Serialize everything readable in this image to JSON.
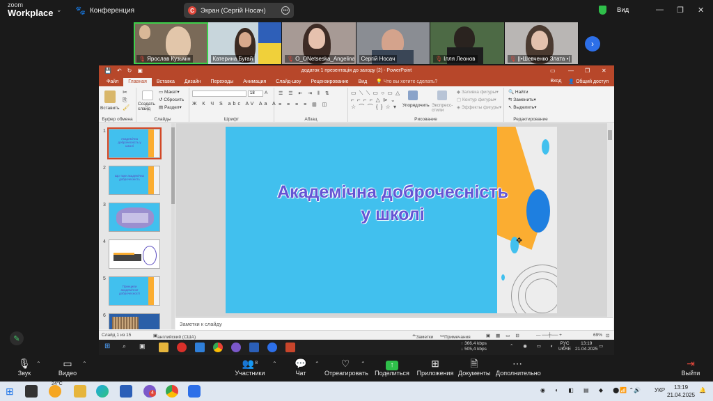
{
  "zoom": {
    "brand_top": "zoom",
    "brand_bottom": "Workplace",
    "meeting_title": "Конференция",
    "screen_share_label": "Экран (Сергій Носач)",
    "screen_share_badge": "С",
    "view_label": "Вид",
    "participants": [
      {
        "name": "Ярослав Кузьмін",
        "muted": true
      },
      {
        "name": "Катерина Бугай",
        "muted": false
      },
      {
        "name": "O_ONetseska_Angelina...",
        "muted": true
      },
      {
        "name": "Сергій Носач",
        "muted": false
      },
      {
        "name": "Ілля Леонов",
        "muted": true
      },
      {
        "name": "||•Шевченко Злата •|",
        "muted": true
      }
    ],
    "toolbar": {
      "audio": "Звук",
      "video": "Видео",
      "participants": "Участники",
      "participants_count": "8",
      "chat": "Чат",
      "react": "Отреагировать",
      "share": "Поделиться",
      "apps": "Приложения",
      "docs": "Документы",
      "more": "Дополнительно",
      "leave": "Выйти"
    },
    "accent_green": "#2fbf4a",
    "accent_blue": "#2d6fe8"
  },
  "ppt": {
    "doc_title": "додаток 1 презентація до заходу (2)  -  PowerPoint",
    "tabs": [
      "Файл",
      "Главная",
      "Вставка",
      "Дизайн",
      "Переходы",
      "Анимация",
      "Слайд-шоу",
      "Рецензирование",
      "Вид"
    ],
    "tell_me": "Что вы хотите сделать?",
    "sign_in": "Вход",
    "share": "Общий доступ",
    "ribbon": {
      "paste": "Вставить",
      "clipboard": "Буфер обмена",
      "new_slide": "Создать слайд",
      "layout": "Макет",
      "reset": "Сбросить",
      "section": "Раздел",
      "slides": "Слайды",
      "font": "Шрифт",
      "font_size": "18",
      "paragraph": "Абзац",
      "arrange": "Упорядочить",
      "quick_styles": "Экспресс-стили",
      "drawing": "Рисование",
      "shape_fill": "Заливка фигуры",
      "shape_outline": "Контур фигуры",
      "shape_effects": "Эффекты фигуры",
      "find": "Найти",
      "replace": "Заменить",
      "select": "Выделить",
      "editing": "Редактирование"
    },
    "thumb_numbers": [
      "1",
      "2",
      "3",
      "4",
      "5",
      "6"
    ],
    "thumb_titles": [
      "Академічна доброчесність у школі",
      "Що таке академічна доброчесність",
      "",
      "",
      "Принципи академічної доброчесності",
      ""
    ],
    "slide_title_line1": "Академічна доброчесність",
    "slide_title_line2": "у школі",
    "notes_placeholder": "Заметки к слайду",
    "status_slide": "Слайд 1 из 15",
    "status_lang": "английский (США)",
    "status_notes": "Заметки",
    "status_comments": "Примечания",
    "zoom_level": "69%",
    "brand_color": "#b7472a"
  },
  "shared_taskbar": {
    "net_up": "366,4 kbps",
    "net_down": "505,4 kbps",
    "lang_top": "РУС",
    "lang_bottom": "UKRE",
    "time": "13:19",
    "date": "21.04.2025"
  },
  "windows_taskbar": {
    "weather": "24°C",
    "lang": "УКР",
    "time": "13:19",
    "date": "21.04.2025",
    "viber_badge": "4"
  }
}
